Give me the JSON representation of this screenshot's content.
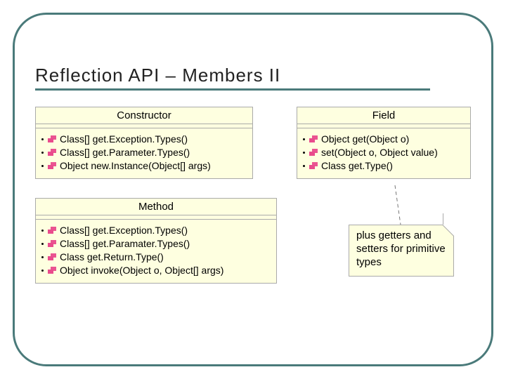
{
  "title": "Reflection API – Members II",
  "boxes": {
    "constructor": {
      "name": "Constructor",
      "members": [
        "Class[] get.Exception.Types()",
        "Class[] get.Parameter.Types()",
        "Object new.Instance(Object[] args)"
      ]
    },
    "field": {
      "name": "Field",
      "members": [
        "Object get(Object o)",
        "set(Object o, Object value)",
        "Class get.Type()"
      ]
    },
    "method": {
      "name": "Method",
      "members": [
        "Class[] get.Exception.Types()",
        "Class[] get.Paramater.Types()",
        "Class get.Return.Type()",
        "Object invoke(Object o, Object[] args)"
      ]
    }
  },
  "note": {
    "text": "plus getters and setters for primitive types"
  },
  "colors": {
    "frame": "#4a7a7a",
    "box_bg": "#feffe0"
  }
}
